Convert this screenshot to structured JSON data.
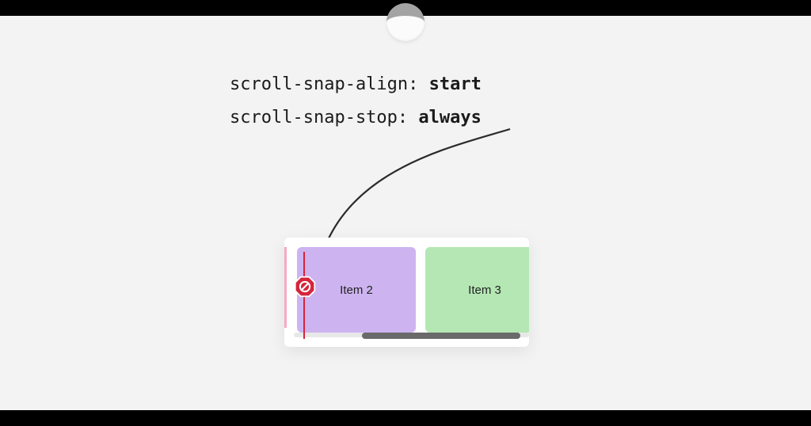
{
  "code": {
    "line1_prop": "scroll-snap-align: ",
    "line1_val": "start",
    "line2_prop": "scroll-snap-stop: ",
    "line2_val": "always"
  },
  "items": {
    "item2": "Item 2",
    "item3": "Item 3"
  },
  "icons": {
    "stop": "stop-sign-icon",
    "arrow": "arrow-icon"
  },
  "colors": {
    "item2_bg": "#cdb4f0",
    "item3_bg": "#b4e7b4",
    "marker": "#d6243b"
  }
}
